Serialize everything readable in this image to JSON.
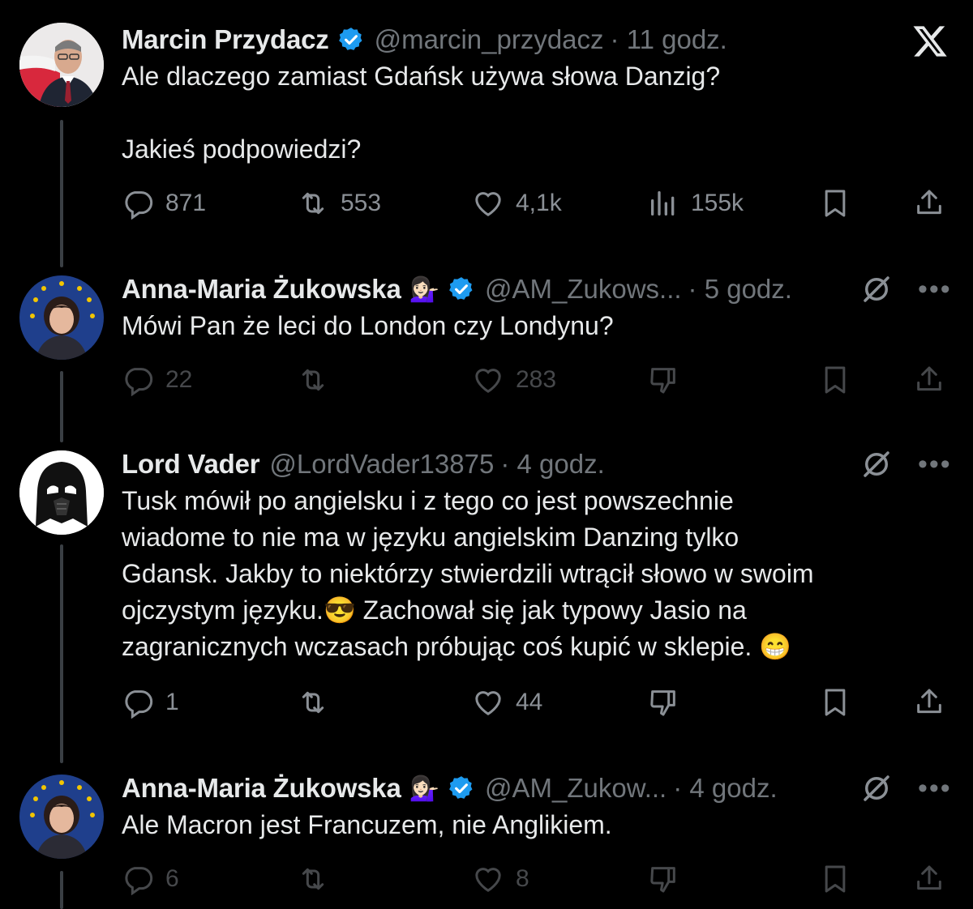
{
  "tweets": [
    {
      "name": "Marcin Przydacz",
      "handle": "@marcin_przydacz",
      "time": "· 11 godz.",
      "text": "Ale dlaczego zamiast Gdańsk używa słowa Danzig?\n\nJakieś podpowiedzi?",
      "replies": "871",
      "retweets": "553",
      "likes": "4,1k",
      "views": "155k"
    },
    {
      "name": "Anna-Maria Żukowska",
      "emoji": "💁🏻‍♀️",
      "handle": "@AM_Zukows...",
      "time": "· 5 godz.",
      "text": "Mówi Pan że leci do London czy Londynu?",
      "replies": "22",
      "retweets": "",
      "likes": "283"
    },
    {
      "name": "Lord Vader",
      "handle": "@LordVader13875",
      "time": "· 4 godz.",
      "text": "Tusk mówił po angielsku i z tego co jest powszechnie\nwiadome to nie ma w języku angielskim Danzing tylko\nGdansk. Jakby to niektórzy stwierdzili wtrącił słowo w swoim\nojczystym języku.😎 Zachował się jak typowy Jasio na\nzagranicznych wczasach próbując coś kupić w sklepie. 😁",
      "replies": "1",
      "retweets": "",
      "likes": "44"
    },
    {
      "name": "Anna-Maria Żukowska",
      "emoji": "💁🏻‍♀️",
      "handle": "@AM_Zukow...",
      "time": "· 4 godz.",
      "text": "Ale Macron jest Francuzem, nie Anglikiem.",
      "replies": "6",
      "retweets": "",
      "likes": "8"
    }
  ],
  "more_label": "•••",
  "colors": {
    "background": "#000000",
    "verified": "#1d9bf0",
    "muted": "#71767b",
    "thread_line": "#3a3f44"
  },
  "icons": [
    "x-logo-icon",
    "verified-badge-icon",
    "reply-icon",
    "retweet-icon",
    "like-icon",
    "views-icon",
    "dislike-icon",
    "bookmark-icon",
    "share-icon",
    "grok-icon",
    "more-icon"
  ]
}
